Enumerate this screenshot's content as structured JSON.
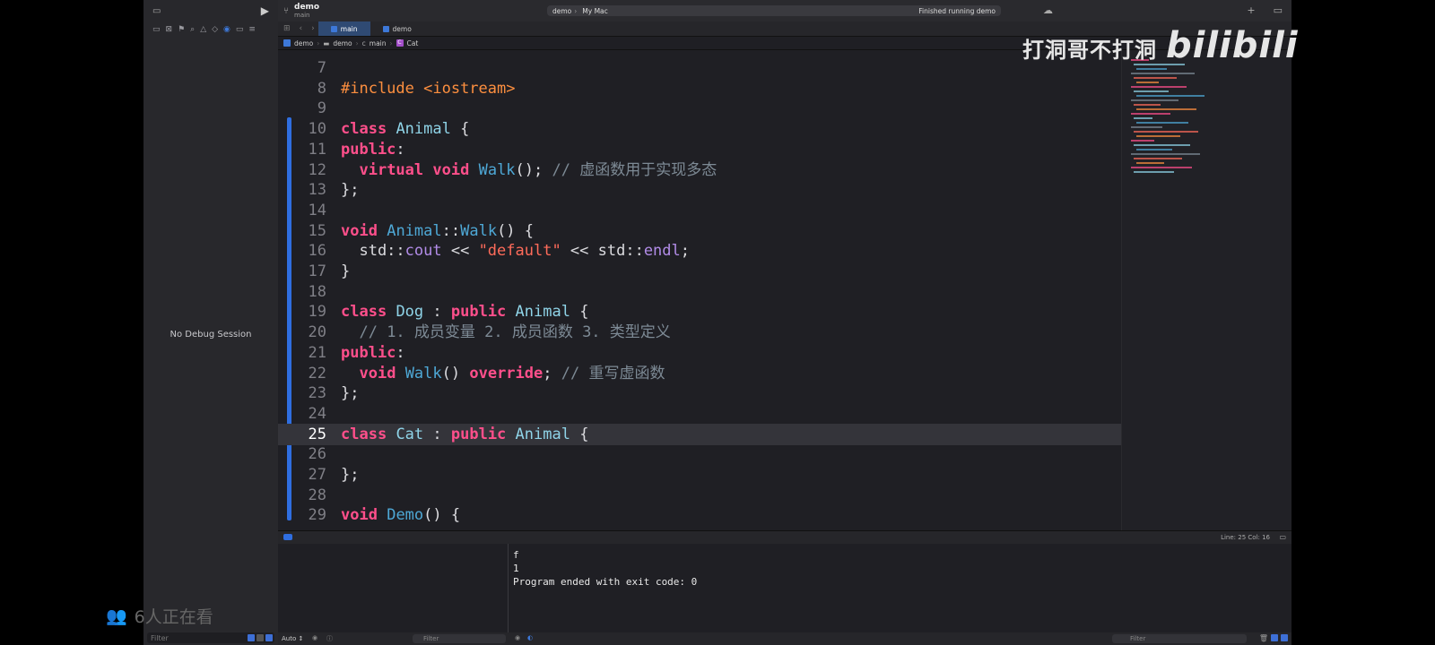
{
  "toolbar": {
    "project_name": "demo",
    "branch": "main",
    "scheme_target": "demo",
    "destination": "My Mac",
    "status": "Finished running demo"
  },
  "tabs": [
    {
      "label": "main",
      "active": true
    },
    {
      "label": "demo",
      "active": false
    }
  ],
  "breadcrumb": [
    "demo",
    "demo",
    "main",
    "Cat"
  ],
  "editor": {
    "current_line": 25,
    "lines": [
      {
        "n": "7",
        "tokens": []
      },
      {
        "n": "8",
        "tokens": [
          {
            "t": "#include ",
            "c": "pp"
          },
          {
            "t": "<iostream>",
            "c": "pp"
          }
        ]
      },
      {
        "n": "9",
        "tokens": []
      },
      {
        "n": "10",
        "tokens": [
          {
            "t": "class",
            "c": "kw"
          },
          {
            "t": " "
          },
          {
            "t": "Animal",
            "c": "ty"
          },
          {
            "t": " {"
          }
        ]
      },
      {
        "n": "11",
        "tokens": [
          {
            "t": "public",
            "c": "kw"
          },
          {
            "t": ":"
          }
        ]
      },
      {
        "n": "12",
        "tokens": [
          {
            "t": "  "
          },
          {
            "t": "virtual",
            "c": "kw"
          },
          {
            "t": " "
          },
          {
            "t": "void",
            "c": "kw"
          },
          {
            "t": " "
          },
          {
            "t": "Walk",
            "c": "fn"
          },
          {
            "t": "(); "
          },
          {
            "t": "// 虚函数用于实现多态",
            "c": "cm"
          }
        ]
      },
      {
        "n": "13",
        "tokens": [
          {
            "t": "};"
          }
        ]
      },
      {
        "n": "14",
        "tokens": []
      },
      {
        "n": "15",
        "tokens": [
          {
            "t": "void",
            "c": "kw"
          },
          {
            "t": " "
          },
          {
            "t": "Animal",
            "c": "fn"
          },
          {
            "t": "::"
          },
          {
            "t": "Walk",
            "c": "fn"
          },
          {
            "t": "() {"
          }
        ]
      },
      {
        "n": "16",
        "tokens": [
          {
            "t": "  std::"
          },
          {
            "t": "cout",
            "c": "md"
          },
          {
            "t": " << "
          },
          {
            "t": "\"default\"",
            "c": "str"
          },
          {
            "t": " << std::"
          },
          {
            "t": "endl",
            "c": "md"
          },
          {
            "t": ";"
          }
        ]
      },
      {
        "n": "17",
        "tokens": [
          {
            "t": "}"
          }
        ]
      },
      {
        "n": "18",
        "tokens": []
      },
      {
        "n": "19",
        "tokens": [
          {
            "t": "class",
            "c": "kw"
          },
          {
            "t": " "
          },
          {
            "t": "Dog",
            "c": "ty"
          },
          {
            "t": " : "
          },
          {
            "t": "public",
            "c": "kw"
          },
          {
            "t": " "
          },
          {
            "t": "Animal",
            "c": "ty"
          },
          {
            "t": " {"
          }
        ]
      },
      {
        "n": "20",
        "tokens": [
          {
            "t": "  "
          },
          {
            "t": "// 1. 成员变量 2. 成员函数 3. 类型定义",
            "c": "cm"
          }
        ]
      },
      {
        "n": "21",
        "tokens": [
          {
            "t": "public",
            "c": "kw"
          },
          {
            "t": ":"
          }
        ]
      },
      {
        "n": "22",
        "tokens": [
          {
            "t": "  "
          },
          {
            "t": "void",
            "c": "kw"
          },
          {
            "t": " "
          },
          {
            "t": "Walk",
            "c": "fn"
          },
          {
            "t": "() "
          },
          {
            "t": "override",
            "c": "kw"
          },
          {
            "t": "; "
          },
          {
            "t": "// 重写虚函数",
            "c": "cm"
          }
        ]
      },
      {
        "n": "23",
        "tokens": [
          {
            "t": "};"
          }
        ]
      },
      {
        "n": "24",
        "tokens": []
      },
      {
        "n": "25",
        "tokens": [
          {
            "t": "class",
            "c": "kw"
          },
          {
            "t": " "
          },
          {
            "t": "Cat",
            "c": "ty"
          },
          {
            "t": " : "
          },
          {
            "t": "public",
            "c": "kw"
          },
          {
            "t": " "
          },
          {
            "t": "Animal",
            "c": "ty"
          },
          {
            "t": " {"
          }
        ]
      },
      {
        "n": "26",
        "tokens": []
      },
      {
        "n": "27",
        "tokens": [
          {
            "t": "};"
          }
        ]
      },
      {
        "n": "28",
        "tokens": []
      },
      {
        "n": "29",
        "tokens": [
          {
            "t": "void",
            "c": "kw"
          },
          {
            "t": " "
          },
          {
            "t": "Demo",
            "c": "fn"
          },
          {
            "t": "() {"
          }
        ]
      }
    ]
  },
  "sidebar": {
    "no_debug": "No Debug Session",
    "filter_placeholder": "Filter"
  },
  "statusbar": {
    "position": "Line: 25  Col: 16"
  },
  "debug": {
    "vars_scope": "Auto ↕",
    "filter_placeholder": "Filter",
    "console_output": "f\n1\nProgram ended with exit code: 0",
    "console_filter_placeholder": "Filter"
  },
  "overlay": {
    "watermark": "打洞哥不打洞",
    "watermark_logo": "bilibili",
    "viewers": "6人正在看"
  },
  "colors": {
    "keyword": "#ff4f8b",
    "type": "#8fd4e8",
    "function": "#4ea8d6",
    "preprocessor": "#fd8f3f",
    "string": "#ff6b5a",
    "comment": "#7d8a95",
    "accent": "#2f6ee0"
  }
}
